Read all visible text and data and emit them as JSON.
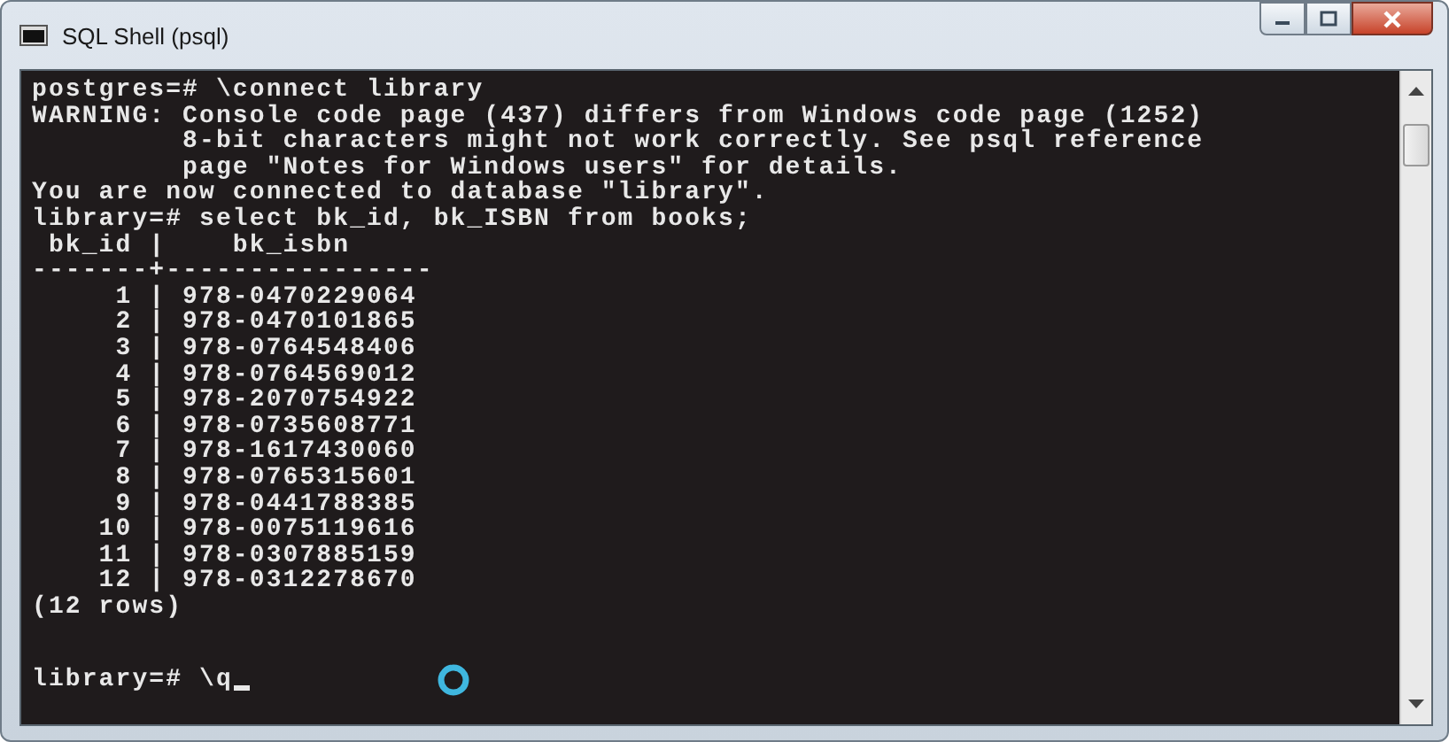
{
  "window": {
    "title": "SQL Shell (psql)"
  },
  "console": {
    "lines": [
      "postgres=# \\connect library",
      "WARNING: Console code page (437) differs from Windows code page (1252)",
      "         8-bit characters might not work correctly. See psql reference",
      "         page \"Notes for Windows users\" for details.",
      "You are now connected to database \"library\".",
      "library=# select bk_id, bk_ISBN from books;",
      " bk_id |    bk_isbn",
      "-------+----------------",
      "     1 | 978-0470229064",
      "     2 | 978-0470101865",
      "     3 | 978-0764548406",
      "     4 | 978-0764569012",
      "     5 | 978-2070754922",
      "     6 | 978-0735608771",
      "     7 | 978-1617430060",
      "     8 | 978-0765315601",
      "     9 | 978-0441788385",
      "    10 | 978-0075119616",
      "    11 | 978-0307885159",
      "    12 | 978-0312278670",
      "(12 rows)"
    ],
    "prompt": "library=# \\q"
  }
}
